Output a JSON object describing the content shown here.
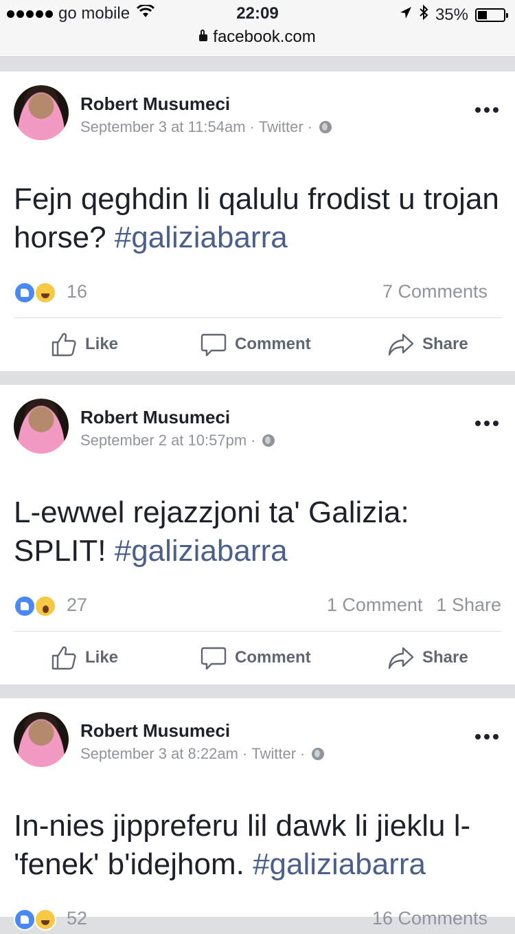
{
  "status_bar": {
    "carrier": "go mobile",
    "time": "22:09",
    "battery": "35%",
    "battery_level": 0.35,
    "url": "facebook.com"
  },
  "posts": [
    {
      "author": "Robert Musumeci",
      "date": "September 3 at 11:54am",
      "source": "Twitter",
      "text": "Fejn qeghdin li qalulu frodist u trojan horse? ",
      "hashtag": "#galiziabarra",
      "reactions": [
        "like",
        "haha"
      ],
      "reaction_count": "16",
      "comments": "7 Comments",
      "shares": ""
    },
    {
      "author": "Robert Musumeci",
      "date": "September 2 at 10:57pm",
      "source": "",
      "text": "L-ewwel rejazzjoni ta' Galizia: SPLIT! ",
      "hashtag": "#galiziabarra",
      "reactions": [
        "like",
        "wow"
      ],
      "reaction_count": "27",
      "comments": "1 Comment",
      "shares": "1 Share"
    },
    {
      "author": "Robert Musumeci",
      "date": "September 3 at 8:22am",
      "source": "Twitter",
      "text": "In-nies jippreferu lil dawk li jieklu l-'fenek' b'idejhom. ",
      "hashtag": "#galiziabarra",
      "reactions": [
        "like",
        "haha"
      ],
      "reaction_count": "52",
      "comments": "16 Comments",
      "shares": ""
    }
  ],
  "actions": {
    "like": "Like",
    "comment": "Comment",
    "share": "Share"
  },
  "separator": "·",
  "icons": [
    "signal-dots-icon",
    "wifi-icon",
    "location-arrow-icon",
    "bluetooth-icon",
    "battery-icon",
    "lock-icon",
    "globe-icon",
    "more-icon",
    "like-icon",
    "comment-icon",
    "share-icon"
  ],
  "colors": {
    "hashtag": "#4b5f8b",
    "meta": "#90949c",
    "like_reaction": "#4a89f3",
    "emoji_reaction": "#f7c844"
  }
}
